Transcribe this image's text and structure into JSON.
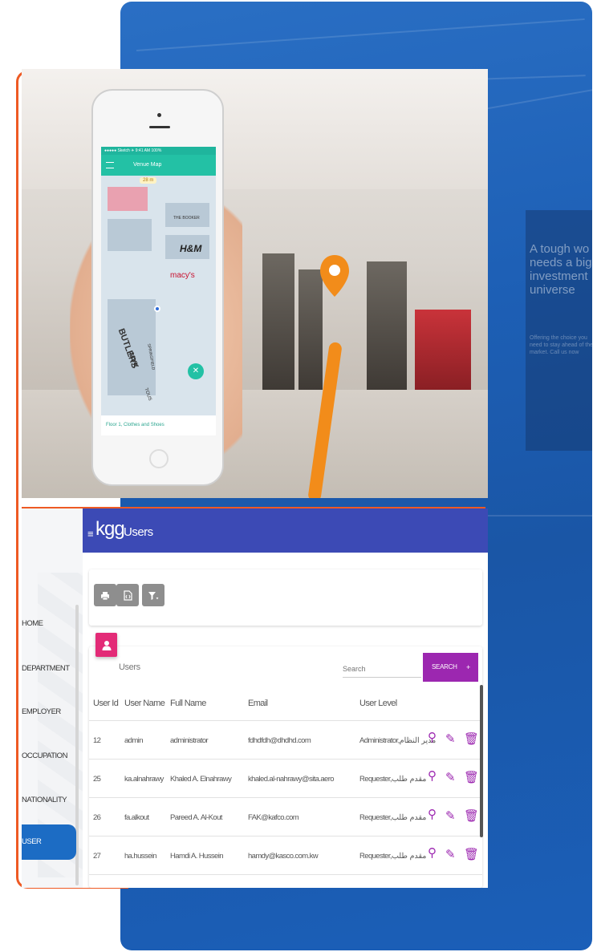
{
  "billboard": {
    "headline": "A tough wo needs a big investment universe",
    "fine_print": "Offering the choice you need to stay ahead of the market. Call us now"
  },
  "phone": {
    "app_title": "Venue Map",
    "status": "●●●●● Sketch ✈  9:41 AM  100%",
    "floor_label": "Floor 1, Clothes and Shoes",
    "distance": "28 m",
    "stores": [
      "THE BOOKER",
      "H&M",
      "macy's",
      "BUTLERS",
      "MVK",
      "SPRINGFIELD",
      "TOUS"
    ]
  },
  "app": {
    "logo": "kgg",
    "title": "Users",
    "sidebar": {
      "items": [
        {
          "label": "HOME",
          "active": false
        },
        {
          "label": "DEPARTMENT",
          "active": false
        },
        {
          "label": "EMPLOYER",
          "active": false
        },
        {
          "label": "OCCUPATION",
          "active": false
        },
        {
          "label": "NATIONALITY",
          "active": false
        },
        {
          "label": "USER",
          "active": true
        }
      ]
    },
    "toolbar": {
      "print_icon": "printer-icon",
      "export_icon": "file-code-icon",
      "filter_icon": "filter-icon"
    },
    "card": {
      "title": "Users",
      "search_placeholder": "Search",
      "search_button": "SEARCH",
      "add_button": "+"
    },
    "table": {
      "headers": [
        "User Id",
        "User Name",
        "Full Name",
        "Email",
        "User Level"
      ],
      "rows": [
        [
          "12",
          "admin",
          "administrator",
          "fdhdfdh@dhdhd.com",
          "Administrator,مدير النظام"
        ],
        [
          "25",
          "ka.alnahrawy",
          "Khaled A. Elnahrawy",
          "khaled.al-nahrawy@sita.aero",
          "Requester,مقدم طلب"
        ],
        [
          "26",
          "fa.alkout",
          "Pareed A. Al-Kout",
          "FAK@kafco.com",
          "Requester,مقدم طلب"
        ],
        [
          "27",
          "ha.hussein",
          "Hamdi A. Hussein",
          "hamdy@kasco.com.kw",
          "Requester,مقدم طلب"
        ]
      ]
    }
  },
  "colors": {
    "blue_panel": "#1d5fb5",
    "orange_frame": "#ee5a24",
    "topbar": "#3c4ab5",
    "accent_purple": "#9c27b0",
    "badge_pink": "#e32b77",
    "active_blue": "#1c6cc4"
  }
}
